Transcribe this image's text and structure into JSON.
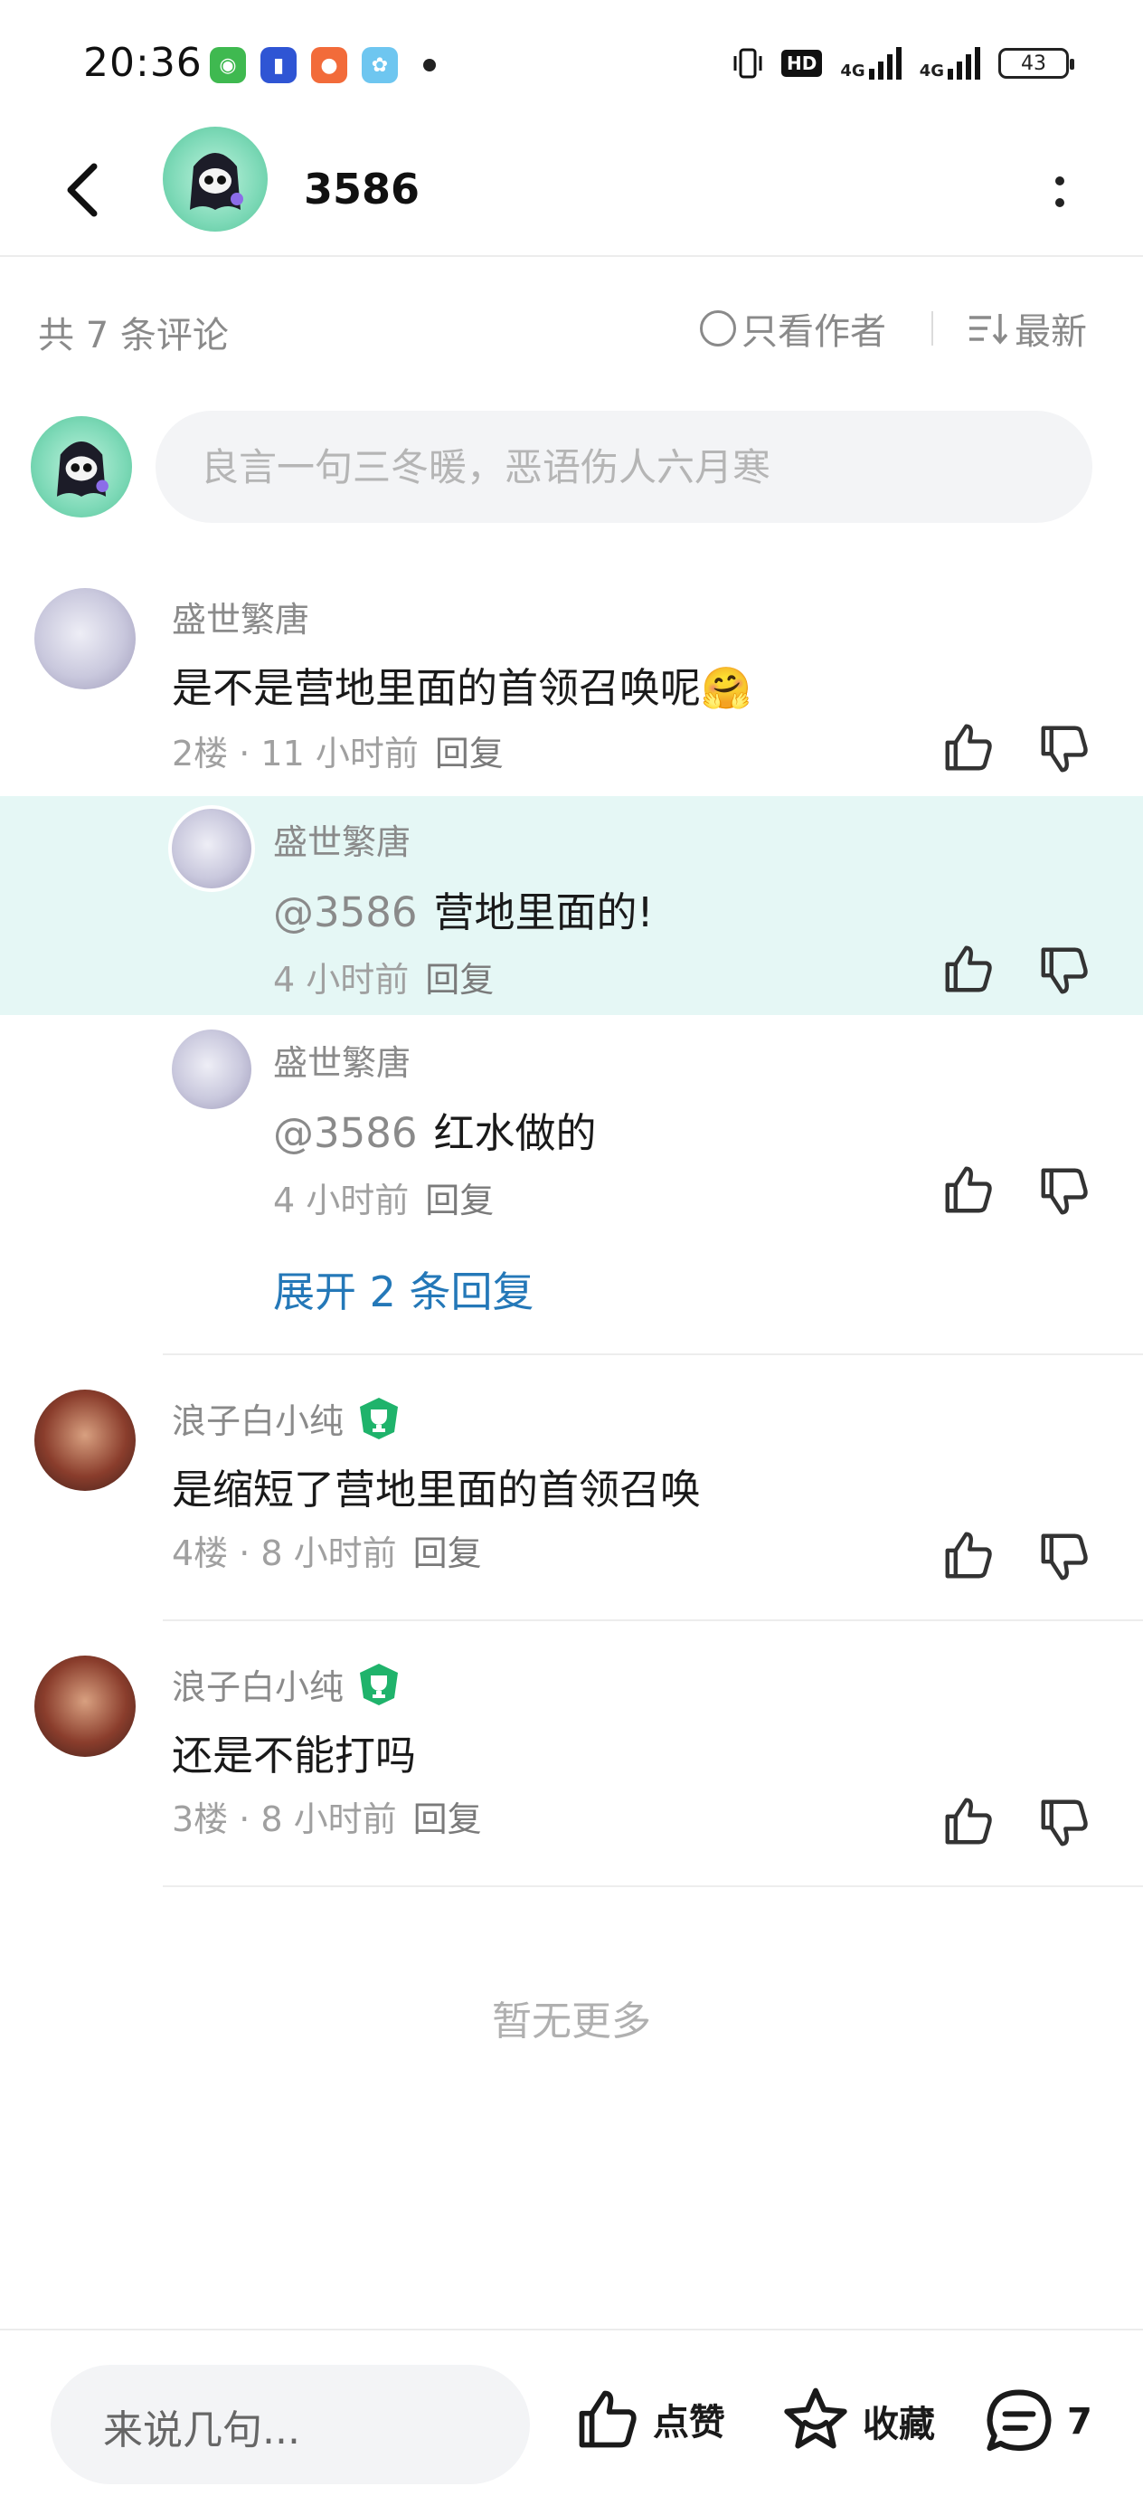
{
  "status_bar": {
    "time": "20:36",
    "network_label": "HD",
    "net1": "4G",
    "net2": "4G",
    "battery": "43"
  },
  "header": {
    "title": "3586"
  },
  "comments_bar": {
    "count_text": "共 7 条评论",
    "author_only_label": "只看作者",
    "sort_label": "最新"
  },
  "composer": {
    "placeholder": "良言一句三冬暖，恶语伤人六月寒"
  },
  "comments": [
    {
      "name": "盛世繁唐",
      "text": "是不是营地里面的首领召唤呢🤗",
      "meta": "2楼 · 11 小时前",
      "reply_label": "回复",
      "replies": [
        {
          "name": "盛世繁唐",
          "mention": "@3586",
          "text": "营地里面的!",
          "meta": "4 小时前",
          "reply_label": "回复"
        },
        {
          "name": "盛世繁唐",
          "mention": "@3586",
          "text": "红水做的",
          "meta": "4 小时前",
          "reply_label": "回复"
        }
      ],
      "expand_label": "展开 2 条回复"
    },
    {
      "name": "浪子白小纯",
      "text": "是缩短了营地里面的首领召唤",
      "meta": "4楼 · 8 小时前",
      "reply_label": "回复"
    },
    {
      "name": "浪子白小纯",
      "text": "还是不能打吗",
      "meta": "3楼 · 8 小时前",
      "reply_label": "回复"
    }
  ],
  "no_more": "暂无更多",
  "bottom_bar": {
    "input_label": "来说几句...",
    "like_label": "点赞",
    "favorite_label": "收藏",
    "comment_count": "7"
  },
  "colors": {
    "accent_link": "#2478b8",
    "highlight_bg": "#e5f7f5",
    "badge_green": "#1fb36b"
  }
}
